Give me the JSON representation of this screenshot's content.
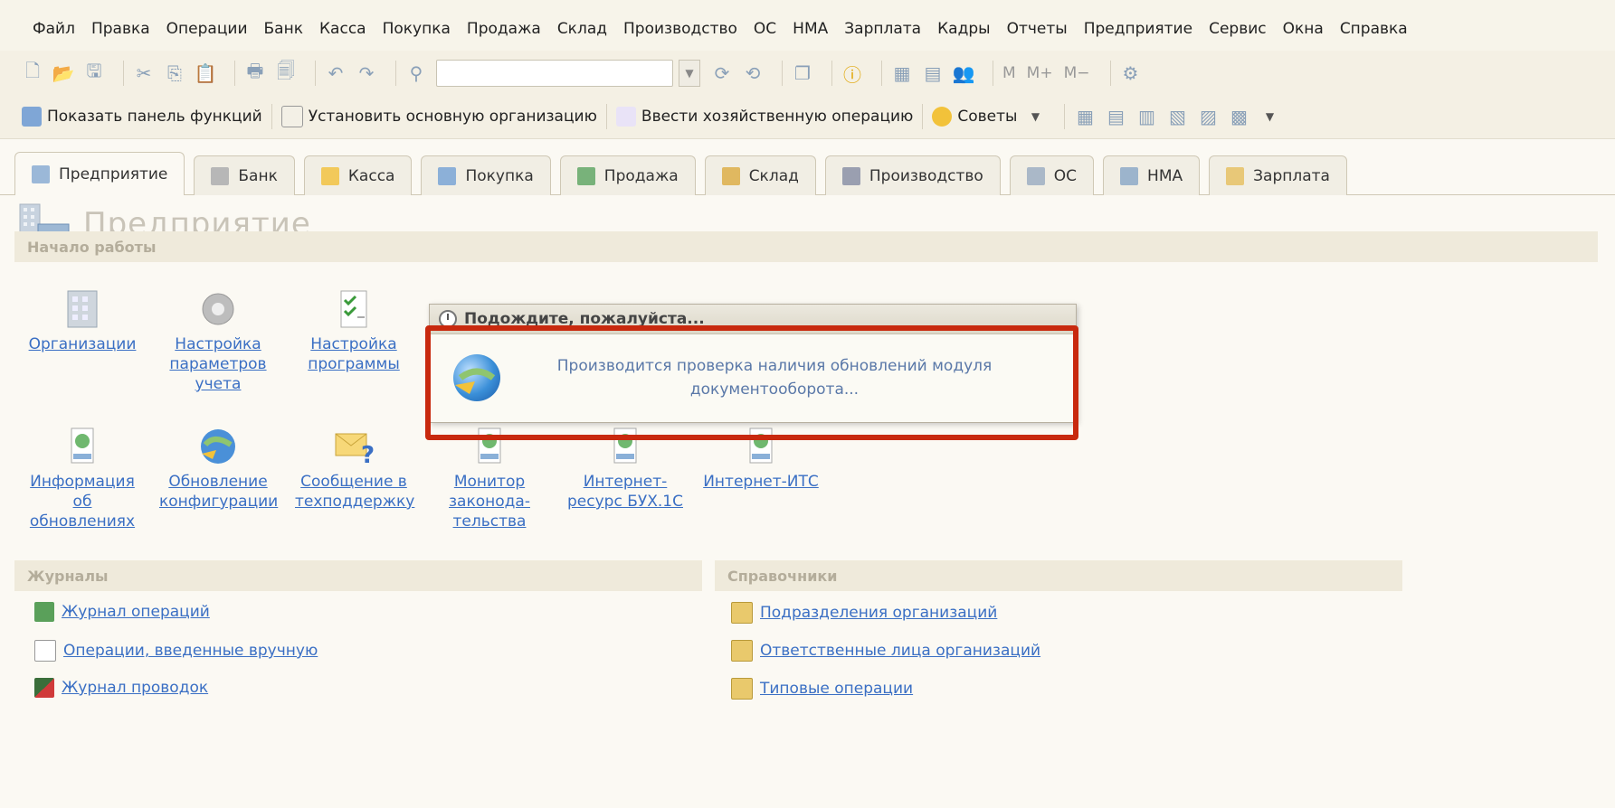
{
  "menu": [
    "Файл",
    "Правка",
    "Операции",
    "Банк",
    "Касса",
    "Покупка",
    "Продажа",
    "Склад",
    "Производство",
    "ОС",
    "НМА",
    "Зарплата",
    "Кадры",
    "Отчеты",
    "Предприятие",
    "Сервис",
    "Окна",
    "Справка"
  ],
  "toolbar2": {
    "show_panel": "Показать панель функций",
    "set_org": "Установить основную организацию",
    "enter_op": "Ввести хозяйственную операцию",
    "tips": "Советы"
  },
  "toolbar1": {
    "m1": "M",
    "m2": "M+",
    "m3": "M−"
  },
  "tabs": [
    "Предприятие",
    "Банк",
    "Касса",
    "Покупка",
    "Продажа",
    "Склад",
    "Производство",
    "ОС",
    "НМА",
    "Зарплата"
  ],
  "page_title": "Предприятие",
  "start": {
    "header": "Начало работы",
    "row1": [
      {
        "label": "Организации"
      },
      {
        "label": "Настройка параметров учета"
      },
      {
        "label": "Настройка программы"
      }
    ],
    "row2": [
      {
        "label": "Информация об обновлениях"
      },
      {
        "label": "Обновление конфигурации"
      },
      {
        "label": "Сообщение в техподдержку"
      },
      {
        "label": "Монитор законода-тельства"
      },
      {
        "label": "Интернет-ресурс БУХ.1С"
      },
      {
        "label": "Интернет-ИТС"
      }
    ]
  },
  "journals": {
    "header": "Журналы",
    "items": [
      "Журнал операций",
      "Операции, введенные вручную",
      "Журнал проводок"
    ]
  },
  "references": {
    "header": "Справочники",
    "items": [
      "Подразделения организаций",
      "Ответственные лица организаций",
      "Типовые операции"
    ]
  },
  "dialog": {
    "title": "Подождите, пожалуйста...",
    "message": "Производится проверка наличия обновлений модуля документооборота..."
  },
  "colors": {
    "highlight": "#c8290e",
    "link": "#3a6fc4"
  }
}
